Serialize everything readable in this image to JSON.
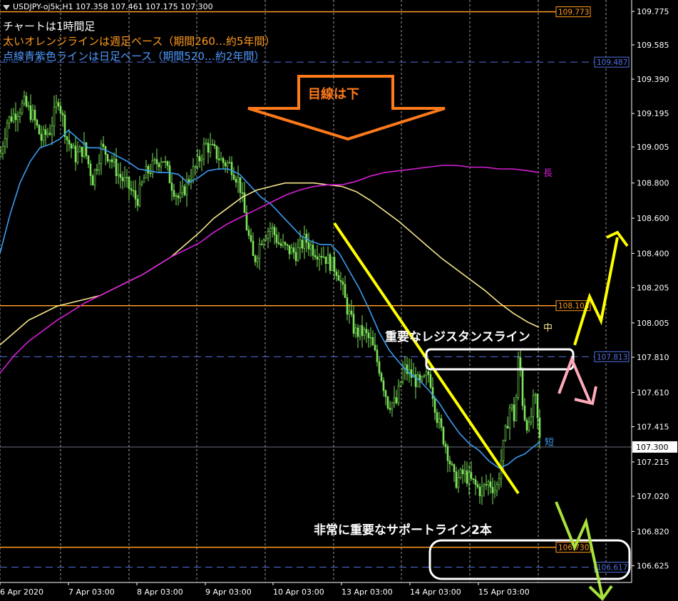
{
  "header": {
    "symbol_line": "USDJPY-oj5k,H1  107.358 107.461 107.175 107.300",
    "lines": [
      "チャートは1時間足",
      "太いオレンジラインは週足ベース（期間260…約5年間）",
      "点線青紫色ラインは日足ベース（期間520…約2年間）"
    ]
  },
  "colors": {
    "background": "#000000",
    "candle_up": "#7de65a",
    "grid": "#c8c8c8",
    "orange_line": "#ff9a1f",
    "blue_dash_line": "#4f6fe0",
    "ma_short": "#3a9bf2",
    "ma_mid": "#f5e68a",
    "ma_long": "#d81ed8",
    "annotation_orange": "#ff7a1a",
    "annotation_yellow": "#ffff00",
    "annotation_pink": "#ffaabb",
    "annotation_green": "#a8e33a"
  },
  "chart_data": {
    "type": "candlestick",
    "symbol": "USDJPY-oj5k",
    "timeframe": "H1",
    "ylim": [
      106.53,
      109.84
    ],
    "y_ticks": [
      "109.775",
      "109.585",
      "109.390",
      "109.195",
      "109.005",
      "108.800",
      "108.600",
      "108.400",
      "108.205",
      "108.005",
      "107.810",
      "107.610",
      "107.415",
      "107.215",
      "107.020",
      "106.820",
      "106.625"
    ],
    "x_ticks": [
      "6 Apr 2020",
      "7 Apr 03:00",
      "8 Apr 03:00",
      "9 Apr 03:00",
      "10 Apr 03:00",
      "13 Apr 03:00",
      "14 Apr 03:00",
      "15 Apr 03:00"
    ],
    "last_price": "107.300",
    "price_path": [
      [
        0,
        108.95
      ],
      [
        10,
        109.15
      ],
      [
        22,
        109.2
      ],
      [
        34,
        109.25
      ],
      [
        46,
        109.18
      ],
      [
        58,
        109.05
      ],
      [
        70,
        109.1
      ],
      [
        82,
        109.28
      ],
      [
        94,
        109.05
      ],
      [
        106,
        108.95
      ],
      [
        118,
        109.0
      ],
      [
        130,
        108.82
      ],
      [
        142,
        109.0
      ],
      [
        154,
        108.95
      ],
      [
        166,
        108.85
      ],
      [
        180,
        108.78
      ],
      [
        192,
        108.7
      ],
      [
        204,
        108.85
      ],
      [
        216,
        108.9
      ],
      [
        228,
        108.95
      ],
      [
        240,
        108.8
      ],
      [
        252,
        108.7
      ],
      [
        264,
        108.82
      ],
      [
        276,
        108.9
      ],
      [
        288,
        109.02
      ],
      [
        300,
        108.98
      ],
      [
        312,
        108.92
      ],
      [
        324,
        108.9
      ],
      [
        336,
        108.8
      ],
      [
        346,
        108.55
      ],
      [
        356,
        108.35
      ],
      [
        368,
        108.5
      ],
      [
        380,
        108.55
      ],
      [
        392,
        108.45
      ],
      [
        404,
        108.42
      ],
      [
        416,
        108.4
      ],
      [
        428,
        108.48
      ],
      [
        440,
        108.42
      ],
      [
        452,
        108.4
      ],
      [
        462,
        108.35
      ],
      [
        474,
        108.3
      ],
      [
        486,
        108.1
      ],
      [
        498,
        107.95
      ],
      [
        510,
        107.95
      ],
      [
        520,
        107.9
      ],
      [
        532,
        107.75
      ],
      [
        544,
        107.55
      ],
      [
        556,
        107.55
      ],
      [
        566,
        107.75
      ],
      [
        578,
        107.7
      ],
      [
        590,
        107.65
      ],
      [
        602,
        107.72
      ],
      [
        614,
        107.45
      ],
      [
        626,
        107.3
      ],
      [
        638,
        107.1
      ],
      [
        650,
        107.15
      ],
      [
        662,
        107.1
      ],
      [
        674,
        107.05
      ],
      [
        686,
        107.1
      ],
      [
        696,
        107.05
      ],
      [
        706,
        107.3
      ],
      [
        716,
        107.55
      ],
      [
        722,
        107.45
      ],
      [
        728,
        107.85
      ],
      [
        734,
        107.5
      ],
      [
        742,
        107.4
      ],
      [
        750,
        107.6
      ],
      [
        758,
        107.3
      ]
    ],
    "series": [
      {
        "name": "短",
        "color": "#3a9bf2",
        "points": [
          [
            0,
            108.4
          ],
          [
            14,
            108.62
          ],
          [
            28,
            108.8
          ],
          [
            42,
            108.92
          ],
          [
            56,
            109.0
          ],
          [
            70,
            109.02
          ],
          [
            84,
            109.05
          ],
          [
            96,
            109.1
          ],
          [
            110,
            109.05
          ],
          [
            124,
            109.0
          ],
          [
            138,
            109.0
          ],
          [
            152,
            108.98
          ],
          [
            166,
            108.95
          ],
          [
            180,
            108.92
          ],
          [
            194,
            108.88
          ],
          [
            208,
            108.87
          ],
          [
            222,
            108.86
          ],
          [
            236,
            108.86
          ],
          [
            250,
            108.85
          ],
          [
            264,
            108.8
          ],
          [
            278,
            108.83
          ],
          [
            292,
            108.87
          ],
          [
            306,
            108.88
          ],
          [
            320,
            108.88
          ],
          [
            336,
            108.85
          ],
          [
            352,
            108.78
          ],
          [
            366,
            108.72
          ],
          [
            380,
            108.68
          ],
          [
            394,
            108.62
          ],
          [
            408,
            108.56
          ],
          [
            422,
            108.5
          ],
          [
            436,
            108.47
          ],
          [
            450,
            108.45
          ],
          [
            464,
            108.45
          ],
          [
            476,
            108.4
          ],
          [
            490,
            108.3
          ],
          [
            504,
            108.2
          ],
          [
            518,
            108.08
          ],
          [
            532,
            107.95
          ],
          [
            546,
            107.85
          ],
          [
            560,
            107.78
          ],
          [
            574,
            107.72
          ],
          [
            588,
            107.68
          ],
          [
            602,
            107.62
          ],
          [
            616,
            107.55
          ],
          [
            630,
            107.46
          ],
          [
            644,
            107.38
          ],
          [
            658,
            107.32
          ],
          [
            672,
            107.28
          ],
          [
            686,
            107.22
          ],
          [
            700,
            107.18
          ],
          [
            712,
            107.2
          ],
          [
            724,
            107.24
          ],
          [
            736,
            107.26
          ],
          [
            748,
            107.3
          ],
          [
            758,
            107.33
          ]
        ]
      },
      {
        "name": "中",
        "color": "#f5e68a",
        "points": [
          [
            0,
            107.88
          ],
          [
            20,
            107.95
          ],
          [
            40,
            108.02
          ],
          [
            60,
            108.06
          ],
          [
            80,
            108.1
          ],
          [
            100,
            108.12
          ],
          [
            120,
            108.14
          ],
          [
            140,
            108.16
          ],
          [
            160,
            108.2
          ],
          [
            180,
            108.24
          ],
          [
            200,
            108.28
          ],
          [
            220,
            108.33
          ],
          [
            240,
            108.38
          ],
          [
            260,
            108.45
          ],
          [
            280,
            108.52
          ],
          [
            300,
            108.6
          ],
          [
            320,
            108.66
          ],
          [
            340,
            108.72
          ],
          [
            360,
            108.76
          ],
          [
            380,
            108.78
          ],
          [
            400,
            108.8
          ],
          [
            420,
            108.8
          ],
          [
            440,
            108.8
          ],
          [
            460,
            108.79
          ],
          [
            480,
            108.78
          ],
          [
            500,
            108.75
          ],
          [
            520,
            108.7
          ],
          [
            540,
            108.64
          ],
          [
            560,
            108.58
          ],
          [
            580,
            108.51
          ],
          [
            600,
            108.44
          ],
          [
            620,
            108.37
          ],
          [
            640,
            108.31
          ],
          [
            660,
            108.25
          ],
          [
            680,
            108.19
          ],
          [
            700,
            108.12
          ],
          [
            720,
            108.06
          ],
          [
            740,
            108.01
          ],
          [
            756,
            107.98
          ]
        ]
      },
      {
        "name": "長",
        "color": "#d81ed8",
        "points": [
          [
            0,
            107.72
          ],
          [
            20,
            107.82
          ],
          [
            40,
            107.9
          ],
          [
            60,
            107.96
          ],
          [
            80,
            108.02
          ],
          [
            100,
            108.07
          ],
          [
            120,
            108.12
          ],
          [
            140,
            108.16
          ],
          [
            160,
            108.2
          ],
          [
            180,
            108.24
          ],
          [
            200,
            108.28
          ],
          [
            220,
            108.33
          ],
          [
            240,
            108.38
          ],
          [
            260,
            108.42
          ],
          [
            280,
            108.46
          ],
          [
            300,
            108.52
          ],
          [
            320,
            108.57
          ],
          [
            340,
            108.61
          ],
          [
            360,
            108.65
          ],
          [
            380,
            108.69
          ],
          [
            400,
            108.73
          ],
          [
            420,
            108.76
          ],
          [
            440,
            108.78
          ],
          [
            460,
            108.79
          ],
          [
            480,
            108.79
          ],
          [
            500,
            108.81
          ],
          [
            520,
            108.84
          ],
          [
            540,
            108.86
          ],
          [
            560,
            108.87
          ],
          [
            580,
            108.88
          ],
          [
            600,
            108.89
          ],
          [
            620,
            108.9
          ],
          [
            640,
            108.9
          ],
          [
            660,
            108.89
          ],
          [
            680,
            108.89
          ],
          [
            700,
            108.88
          ],
          [
            720,
            108.88
          ],
          [
            740,
            108.87
          ],
          [
            756,
            108.86
          ]
        ]
      }
    ],
    "horizontal_lines": [
      {
        "price": 109.773,
        "label": "109.773",
        "style": "orange"
      },
      {
        "price": 109.487,
        "label": "109.487",
        "style": "blue_dash"
      },
      {
        "price": 108.103,
        "label": "108.103",
        "style": "orange"
      },
      {
        "price": 107.813,
        "label": "107.813",
        "style": "blue_dash"
      },
      {
        "price": 106.73,
        "label": "106.730",
        "style": "orange"
      },
      {
        "price": 106.617,
        "label": "106.617",
        "style": "blue_dash"
      }
    ],
    "annotations": {
      "down_arrow_text": "目線は下",
      "resistance_text": "重要なレジスタンスライン",
      "support_text": "非常に重要なサポートライン2本"
    }
  }
}
